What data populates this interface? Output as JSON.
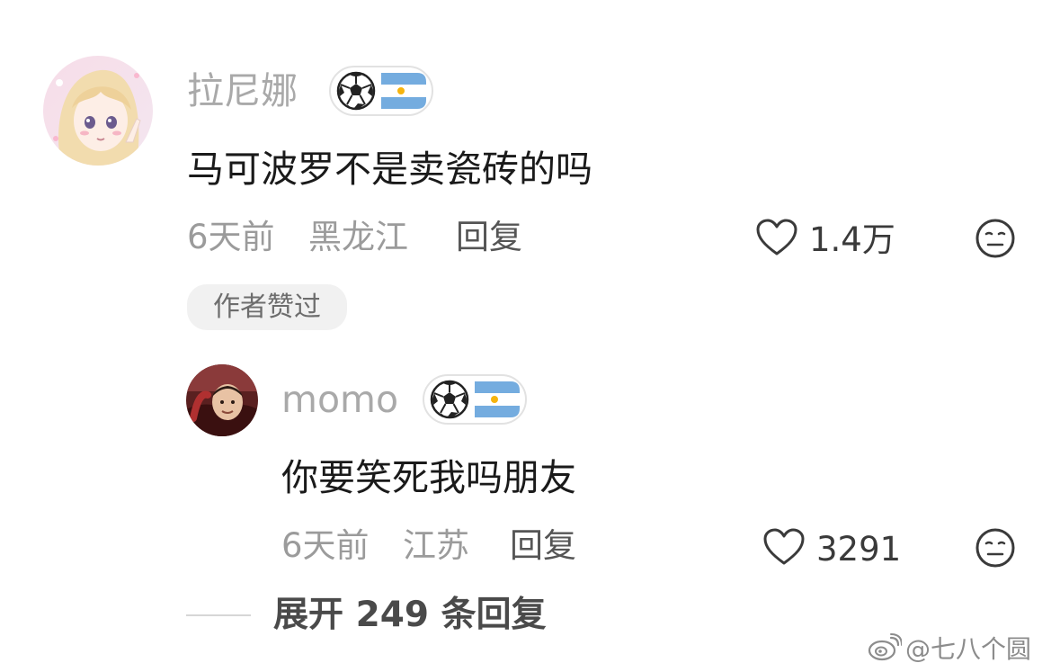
{
  "comment": {
    "username": "拉尼娜",
    "text": "马可波罗不是卖瓷砖的吗",
    "time": "6天前",
    "location": "黑龙江",
    "reply_label": "回复",
    "likes": "1.4万",
    "author_liked_label": "作者赞过",
    "badge_icons": [
      "soccer-ball-icon",
      "argentina-flag-icon"
    ],
    "reaction_icon": "neutral-face-icon"
  },
  "reply": {
    "username": "momo",
    "text": "你要笑死我吗朋友",
    "time": "6天前",
    "location": "江苏",
    "reply_label": "回复",
    "likes": "3291",
    "badge_icons": [
      "soccer-ball-icon",
      "argentina-flag-icon"
    ],
    "reaction_icon": "neutral-face-icon"
  },
  "expand": {
    "label": "展开 249 条回复"
  },
  "watermark": {
    "text": "@七八个圆",
    "icon": "weibo-logo-icon"
  },
  "colors": {
    "username": "#a9a9a9",
    "comment_text": "#1a1a1a",
    "meta": "#9b9b9b",
    "flag_blue": "#74acdf"
  }
}
